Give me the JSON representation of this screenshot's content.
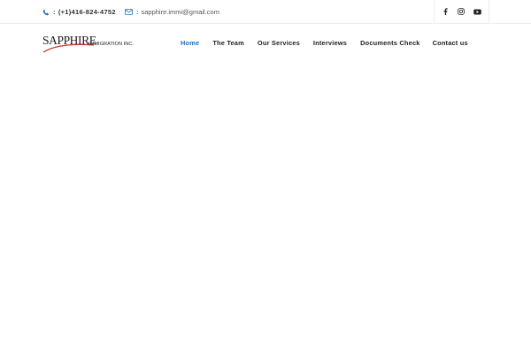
{
  "topbar": {
    "phone": {
      "icon": "phone-icon",
      "separator": ":",
      "text": "(+1)416-824-4752"
    },
    "email": {
      "icon": "envelope-icon",
      "separator": ":",
      "text": "sapphire.immi@gmail.com"
    },
    "socials": [
      {
        "icon": "facebook-icon"
      },
      {
        "icon": "instagram-icon"
      },
      {
        "icon": "youtube-icon"
      }
    ]
  },
  "logo": {
    "main": "SAPPHIRE",
    "sub": "IMMIGRATION INC."
  },
  "nav": {
    "items": [
      {
        "label": "Home",
        "active": true
      },
      {
        "label": "The Team",
        "active": false
      },
      {
        "label": "Our Services",
        "active": false
      },
      {
        "label": "Interviews",
        "active": false
      },
      {
        "label": "Documents Check",
        "active": false
      },
      {
        "label": "Contact us",
        "active": false
      }
    ]
  },
  "colors": {
    "accent": "#1e70b6",
    "text": "#222222",
    "logo_swoosh": "#c0392b"
  }
}
